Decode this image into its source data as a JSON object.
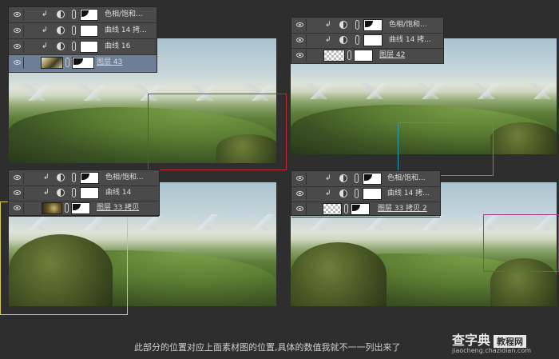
{
  "caption": "此部分的位置对应上面素材图的位置,具体的数值我就不一一列出来了",
  "watermark": {
    "brand": "查字典",
    "badge": "教程网",
    "url": "jiaocheng.chazidian.com"
  },
  "colors": {
    "red_frame": "#c0282d",
    "cyan_frame": "#2a9bb0",
    "yellow_frame": "#d9c84a",
    "magenta_frame": "#a63b8a",
    "selected_row": "#6d7f97"
  },
  "panels": [
    {
      "rows": [
        {
          "label": "色相/饱和...",
          "clipped": true,
          "adjustment": true,
          "selected": false
        },
        {
          "label": "曲线 14 拷...",
          "clipped": true,
          "adjustment": true,
          "selected": false
        },
        {
          "label": "曲线 16",
          "clipped": true,
          "adjustment": true,
          "selected": false
        },
        {
          "label": "图层 43",
          "clipped": false,
          "adjustment": false,
          "selected": true
        }
      ]
    },
    {
      "rows": [
        {
          "label": "色相/饱和...",
          "clipped": true,
          "adjustment": true,
          "selected": false
        },
        {
          "label": "曲线 14 拷...",
          "clipped": true,
          "adjustment": true,
          "selected": false
        },
        {
          "label": "图层 42",
          "clipped": false,
          "adjustment": false,
          "selected": false
        }
      ]
    },
    {
      "rows": [
        {
          "label": "色相/饱和...",
          "clipped": true,
          "adjustment": true,
          "selected": false
        },
        {
          "label": "曲线 14",
          "clipped": true,
          "adjustment": true,
          "selected": false
        },
        {
          "label": "图层 33 拷贝",
          "clipped": false,
          "adjustment": false,
          "selected": false
        }
      ]
    },
    {
      "rows": [
        {
          "label": "色相/饱和...",
          "clipped": true,
          "adjustment": true,
          "selected": false
        },
        {
          "label": "曲线 14 拷...",
          "clipped": true,
          "adjustment": true,
          "selected": false
        },
        {
          "label": "图层 33 拷贝 2",
          "clipped": false,
          "adjustment": false,
          "selected": false
        }
      ]
    }
  ]
}
